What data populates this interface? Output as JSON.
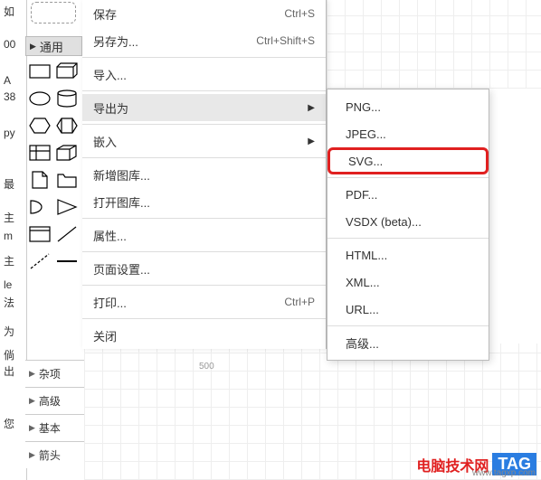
{
  "bg": {
    "l1": "如",
    "l2": "00",
    "l3": "A",
    "l4": "38",
    "l5": "py",
    "l6": "最",
    "l7": "主",
    "l8": "m",
    "l9": "主",
    "l10": "le",
    "l11": "法",
    "l12": "为",
    "l13": "倘",
    "l14": "出",
    "l15": "您"
  },
  "collapsed_panel": "通用",
  "ruler": "500",
  "menu": {
    "save": {
      "label": "保存",
      "shortcut": "Ctrl+S"
    },
    "saveas": {
      "label": "另存为...",
      "shortcut": "Ctrl+Shift+S"
    },
    "import": {
      "label": "导入..."
    },
    "export": {
      "label": "导出为"
    },
    "embed": {
      "label": "嵌入"
    },
    "newlib": {
      "label": "新增图库..."
    },
    "openlib": {
      "label": "打开图库..."
    },
    "props": {
      "label": "属性..."
    },
    "pagesetup": {
      "label": "页面设置..."
    },
    "print": {
      "label": "打印...",
      "shortcut": "Ctrl+P"
    },
    "close": {
      "label": "关闭"
    }
  },
  "submenu": {
    "png": "PNG...",
    "jpeg": "JPEG...",
    "svg": "SVG...",
    "pdf": "PDF...",
    "vsdx": "VSDX (beta)...",
    "html": "HTML...",
    "xml": "XML...",
    "url": "URL...",
    "adv": "高级..."
  },
  "categories": {
    "misc": "杂项",
    "adv": "高级",
    "basic": "基本",
    "arrow": "箭头"
  },
  "watermark": {
    "site": "电脑技术网",
    "tag": "TAG",
    "url": "www.tagxp.com"
  }
}
